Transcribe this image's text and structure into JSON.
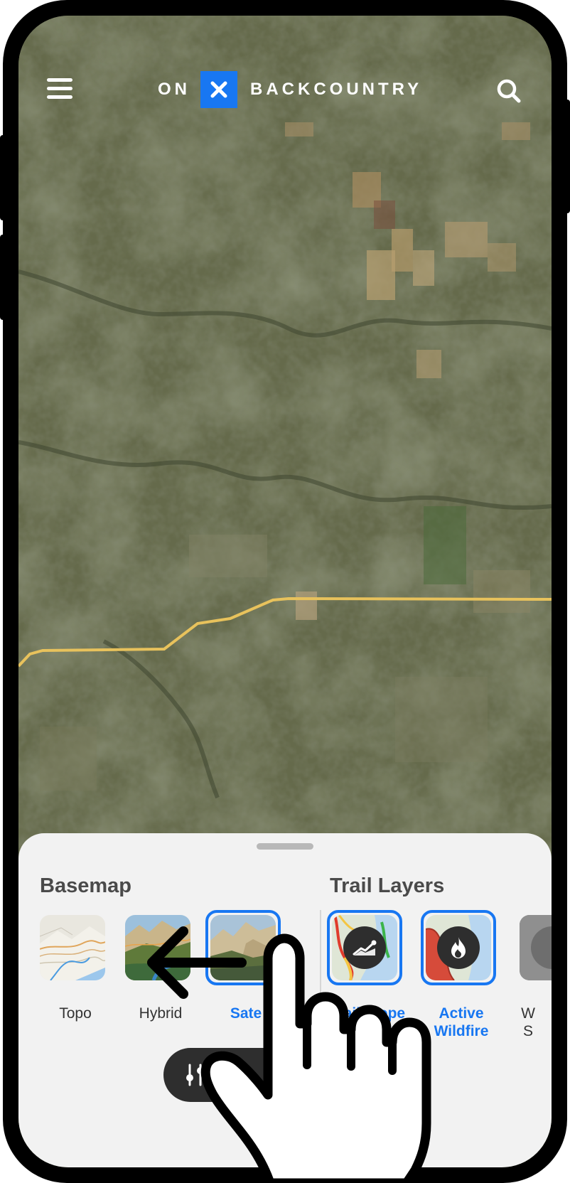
{
  "app": {
    "logo_left": "ON",
    "logo_right": "BACKCOUNTRY",
    "brand_color": "#1877f2",
    "icons": {
      "menu": "hamburger-menu-icon",
      "search": "magnifier-icon",
      "logo_mark": "x-icon"
    }
  },
  "bottom_sheet": {
    "basemap": {
      "title": "Basemap",
      "items": [
        {
          "label": "Topo",
          "selected": false
        },
        {
          "label": "Hybrid",
          "selected": false
        },
        {
          "label": "Sate",
          "selected": true
        }
      ]
    },
    "trail_layers": {
      "title": "Trail Layers",
      "items": [
        {
          "label": "Trail Slope",
          "icon": "slope-chart-icon",
          "selected": true
        },
        {
          "label_line1": "Active",
          "label_line2": "Wildfire",
          "icon": "flame-icon",
          "selected": true
        },
        {
          "label_line1": "W",
          "label_line2": "S",
          "icon": "weather-icon",
          "selected": false
        }
      ]
    },
    "layers_button": {
      "label": "L",
      "icon": "sliders-icon"
    }
  },
  "gesture": {
    "hand_icon": "pointing-hand-icon",
    "arrow_icon": "left-arrow-icon",
    "direction": "left"
  },
  "colors": {
    "selection": "#1877f2",
    "trail_line": "#e8c25c",
    "sheet_bg": "#f2f2f2"
  }
}
